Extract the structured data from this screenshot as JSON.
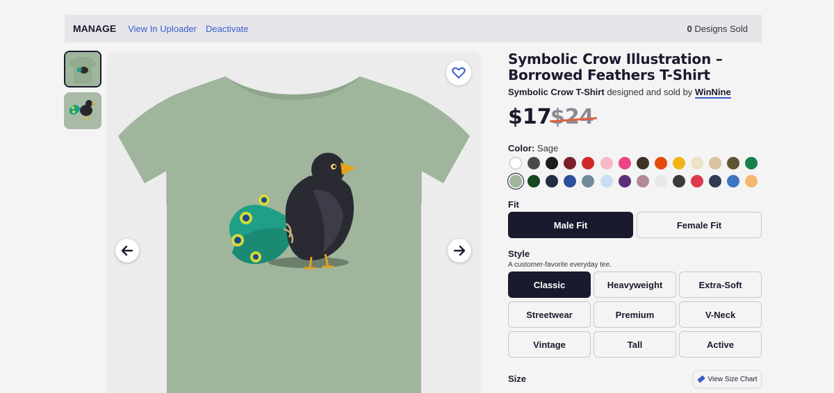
{
  "manage_bar": {
    "manage_label": "MANAGE",
    "view_in_uploader": "View In Uploader",
    "deactivate": "Deactivate",
    "sold_count": "0",
    "sold_label": "Designs Sold"
  },
  "product": {
    "title": "Symbolic Crow Illustration – Borrowed Feathers T-Shirt",
    "design_name": "Symbolic Crow T-Shirt",
    "designed_by_text": "designed and sold by",
    "artist": "WinNine",
    "price": "$17",
    "old_price": "$24"
  },
  "color": {
    "label": "Color:",
    "selected": "Sage",
    "swatches_row1": [
      "#ffffff",
      "#4a4a4a",
      "#1c1c1c",
      "#7a1f2a",
      "#cf2a2a",
      "#f7b8c8",
      "#ec4486",
      "#3e3128",
      "#e34b0e",
      "#f2b316",
      "#ece2c8",
      "#d7c3a0",
      "#5e5433",
      "#17814a"
    ],
    "swatches_row2": [
      "#9fb59c",
      "#17461f",
      "#242d45",
      "#2f4f9d",
      "#6f8b9c",
      "#c7dff0",
      "#5c2f78",
      "#b38a96",
      "#e8e8e8",
      "#3b3b3e",
      "#dc3a4f",
      "#2f3b52",
      "#3f74c2",
      "#f3b86e"
    ],
    "selected_index_row2": 0
  },
  "fit": {
    "label": "Fit",
    "options": [
      "Male Fit",
      "Female Fit"
    ],
    "selected": "Male Fit"
  },
  "style": {
    "label": "Style",
    "subtitle": "A customer-favorite everyday tee.",
    "options": [
      "Classic",
      "Heavyweight",
      "Extra-Soft",
      "Streetwear",
      "Premium",
      "V-Neck",
      "Vintage",
      "Tall",
      "Active"
    ],
    "selected": "Classic"
  },
  "size": {
    "label": "Size",
    "chart_button": "View Size Chart"
  },
  "colors": {
    "shirt": "#9fb59c",
    "accent": "#3a5ccc",
    "dark": "#1a1a2e"
  }
}
